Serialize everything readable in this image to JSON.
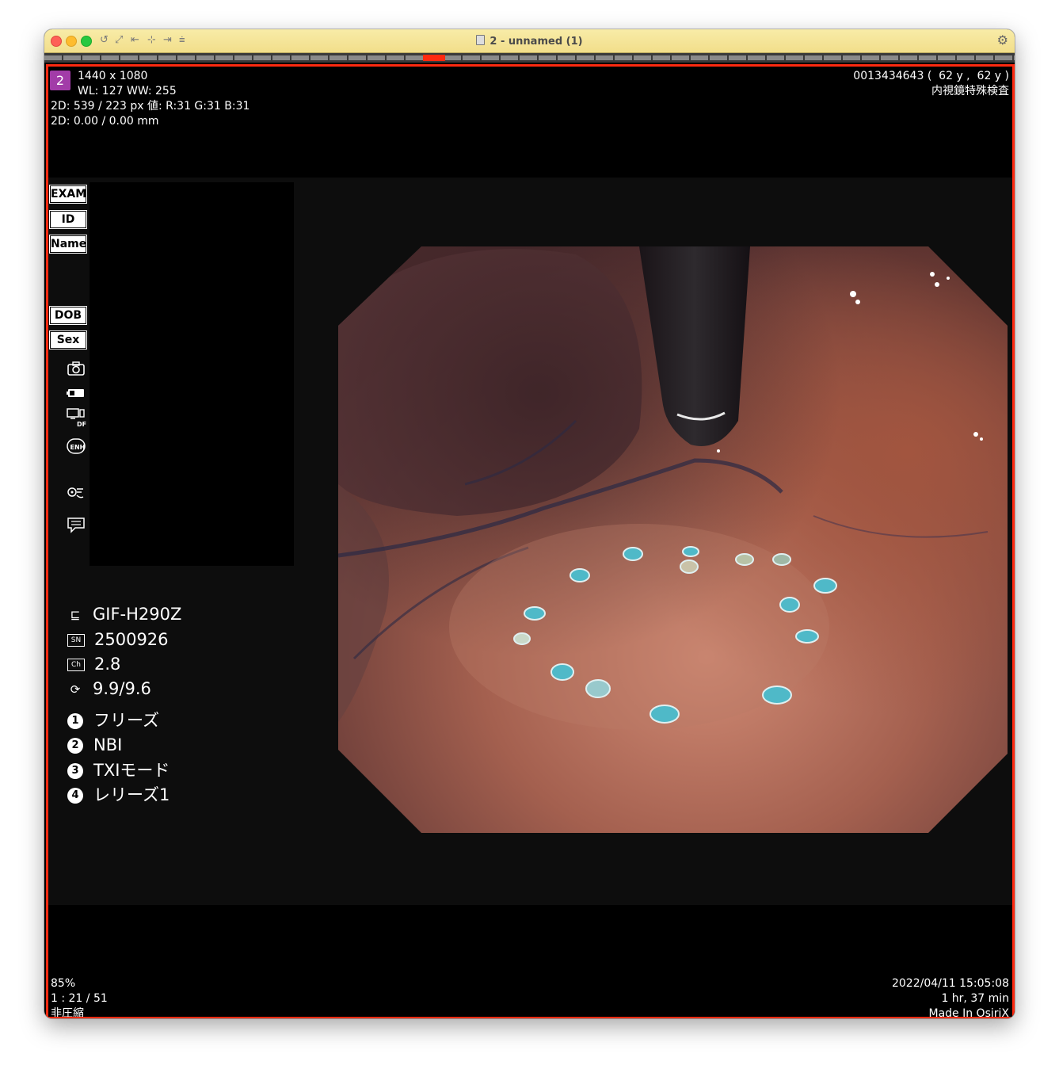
{
  "window": {
    "title": "2 - unnamed (1)",
    "toolbar_icons": [
      "undo-icon",
      "fullscreen-icon",
      "first-image-icon",
      "center-icon",
      "last-image-icon",
      "stack-icon"
    ]
  },
  "overlay": {
    "series_badge": "2",
    "dimensions": "1440 x 1080",
    "window_level": "WL: 127 WW: 255",
    "pixel_value": "2D: 539 / 223 px 値: R:31 G:31 B:31",
    "measurement": "2D: 0.00 / 0.00 mm",
    "patient_id_age": "0013434643 (  62 y ,  62 y )",
    "study_description": "内視鏡特殊検査",
    "zoom": "85%",
    "frame": "1 : 21 / 51",
    "compression": "非圧縮",
    "datetime": "2022/04/11 15:05:08",
    "duration": "1 hr, 37 min",
    "made_in": "Made In OsiriX"
  },
  "patient_panel": {
    "labels": [
      "EXAM",
      "ID",
      "Name",
      "DOB",
      "Sex"
    ]
  },
  "scope_info": {
    "model": "GIF-H290Z",
    "serial_label": "SN",
    "serial": "2500926",
    "channel_label": "Ch",
    "channel": "2.8",
    "ratio": "9.9/9.6",
    "modes": [
      {
        "num": "1",
        "label": "フリーズ"
      },
      {
        "num": "2",
        "label": "NBI"
      },
      {
        "num": "3",
        "label": "TXIモード"
      },
      {
        "num": "4",
        "label": "レリーズ1"
      }
    ],
    "status_icons": [
      "camera-icon",
      "battery-icon",
      "display-df-icon",
      "enh-icon",
      "scope-settings-icon",
      "comment-icon"
    ]
  }
}
